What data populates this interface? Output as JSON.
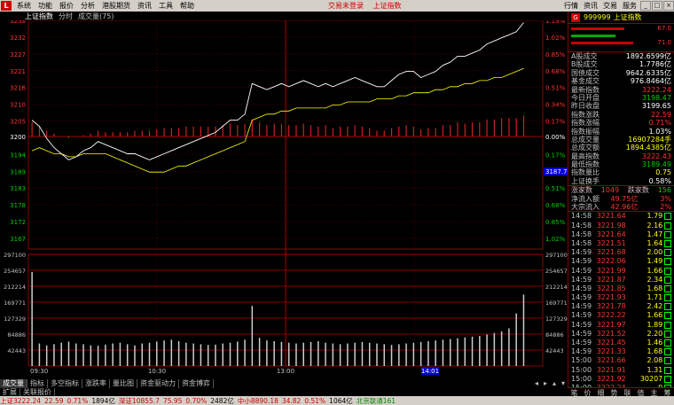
{
  "menu": {
    "logo": "L",
    "items": [
      "系统",
      "功能",
      "报价",
      "分析",
      "港股期货",
      "资讯",
      "工具",
      "帮助"
    ],
    "center": [
      "交易未登录",
      "上证指数"
    ],
    "right": [
      "行情",
      "资讯",
      "交易",
      "服务"
    ]
  },
  "header": {
    "index_name": "上证指数",
    "mode": "分时",
    "indicator": "成交量(75)"
  },
  "chart_data": {
    "type": "line",
    "y_left_ticks": [
      3238,
      3232,
      3227,
      3221,
      3216,
      3210,
      3205,
      3200,
      3194,
      3189,
      3183,
      3178,
      3172,
      3167
    ],
    "y_right_ticks": [
      "1.19%",
      "1.02%",
      "0.85%",
      "0.68%",
      "0.51%",
      "0.34%",
      "0.17%",
      "0.00%",
      "0.17%",
      "0.34%",
      "0.51%",
      "0.68%",
      "0.85%",
      "1.02%"
    ],
    "vol_ticks_left": [
      297100,
      254657,
      212214,
      169771,
      127329,
      84886,
      42443
    ],
    "vol_ticks_right": [
      297100,
      254657,
      212214,
      169771,
      127329,
      84886,
      42443
    ],
    "x_labels": [
      "09:30",
      "10:30",
      "13:00",
      "14:01"
    ],
    "base_price": 3199.65,
    "hover_price": "3187.74",
    "price_line": [
      3205,
      3203,
      3199,
      3196,
      3194,
      3192,
      3193,
      3195,
      3196,
      3198,
      3197,
      3196,
      3195,
      3194,
      3194,
      3193,
      3192,
      3193,
      3194,
      3195,
      3196,
      3197,
      3198,
      3199,
      3200,
      3201,
      3203,
      3205,
      3205,
      3207,
      3217,
      3216,
      3215,
      3216,
      3217,
      3216,
      3217,
      3218,
      3217,
      3216,
      3217,
      3216,
      3217,
      3218,
      3219,
      3218,
      3217,
      3216,
      3216,
      3218,
      3220,
      3221,
      3221,
      3219,
      3220,
      3221,
      3223,
      3224,
      3226,
      3226,
      3227,
      3228,
      3230,
      3231,
      3232,
      3233,
      3234,
      3237
    ],
    "avg_line": [
      3195,
      3196,
      3195,
      3194,
      3194,
      3193,
      3193,
      3194,
      3194,
      3194,
      3194,
      3193,
      3192,
      3191,
      3190,
      3189,
      3188,
      3188,
      3188,
      3189,
      3190,
      3190,
      3191,
      3192,
      3193,
      3194,
      3195,
      3196,
      3197,
      3198,
      3205,
      3206,
      3207,
      3207,
      3208,
      3208,
      3209,
      3209,
      3209,
      3209,
      3209,
      3210,
      3210,
      3211,
      3211,
      3211,
      3211,
      3212,
      3212,
      3212,
      3213,
      3213,
      3214,
      3214,
      3214,
      3215,
      3215,
      3216,
      3216,
      3217,
      3217,
      3218,
      3218,
      3219,
      3219,
      3220,
      3221,
      3222
    ],
    "volume": [
      250000,
      60000,
      55000,
      58000,
      62000,
      65000,
      60000,
      58000,
      55000,
      54000,
      57000,
      60000,
      62000,
      58000,
      55000,
      60000,
      62000,
      65000,
      68000,
      70000,
      66000,
      62000,
      60000,
      58000,
      56000,
      57000,
      60000,
      62000,
      65000,
      70000,
      160000,
      75000,
      68000,
      66000,
      64000,
      62000,
      60000,
      62000,
      64000,
      66000,
      62000,
      60000,
      58000,
      60000,
      62000,
      64000,
      62000,
      60000,
      58000,
      56000,
      58000,
      60000,
      62000,
      64000,
      66000,
      68000,
      70000,
      72000,
      74000,
      76000,
      78000,
      80000,
      84000,
      88000,
      92000,
      100000,
      140000,
      190000
    ]
  },
  "panel": {
    "g_label": "G",
    "code": "999999",
    "name": "上证指数",
    "bar_vals": [
      "67.0",
      "71.0"
    ],
    "kv": [
      {
        "k": "A股成交",
        "v": "1892.6599亿",
        "c": "wht"
      },
      {
        "k": "B股成交",
        "v": "1.7786亿",
        "c": "wht"
      },
      {
        "k": "国债成交",
        "v": "9642.6335亿",
        "c": "wht"
      },
      {
        "k": "基金成交",
        "v": "976.8464亿",
        "c": "wht"
      },
      {
        "k": "最新指数",
        "v": "3222.24",
        "c": "red"
      },
      {
        "k": "今日开盘",
        "v": "3198.47",
        "c": "grn"
      },
      {
        "k": "昨日收盘",
        "v": "3199.65",
        "c": "wht"
      },
      {
        "k": "指数涨跌",
        "v": "22.59",
        "c": "red"
      },
      {
        "k": "指数涨幅",
        "v": "0.71%",
        "c": "red"
      },
      {
        "k": "指数振幅",
        "v": "1.03%",
        "c": "wht"
      },
      {
        "k": "总成交量",
        "v": "16907284手",
        "c": "yel"
      },
      {
        "k": "总成交额",
        "v": "1894.4385亿",
        "c": "yel"
      },
      {
        "k": "最高指数",
        "v": "3222.43",
        "c": "red"
      },
      {
        "k": "最低指数",
        "v": "3189.49",
        "c": "grn"
      },
      {
        "k": "指数量比",
        "v": "0.75",
        "c": "yel"
      },
      {
        "k": "上证换手",
        "v": "0.58%",
        "c": "wht"
      }
    ],
    "stats": [
      {
        "k1": "涨家数",
        "v1": "1049",
        "k2": "跌家数",
        "v2": "156"
      },
      {
        "k1": "净流入额",
        "v1": "49.75亿",
        "k2": "",
        "v2": "3%"
      },
      {
        "k1": "大宗流入",
        "v1": "42.96亿",
        "k2": "",
        "v2": "2%"
      }
    ],
    "ticks": [
      {
        "t": "14:58",
        "p": "3221.64",
        "v": "1.79"
      },
      {
        "t": "14:58",
        "p": "3221.98",
        "v": "2.16"
      },
      {
        "t": "14:58",
        "p": "3221.64",
        "v": "1.47"
      },
      {
        "t": "14:58",
        "p": "3221.51",
        "v": "1.64"
      },
      {
        "t": "14:59",
        "p": "3221.68",
        "v": "2.00"
      },
      {
        "t": "14:59",
        "p": "3222.06",
        "v": "1.49"
      },
      {
        "t": "14:59",
        "p": "3221.99",
        "v": "1.66"
      },
      {
        "t": "14:59",
        "p": "3221.87",
        "v": "2.34"
      },
      {
        "t": "14:59",
        "p": "3221.85",
        "v": "1.68"
      },
      {
        "t": "14:59",
        "p": "3221.93",
        "v": "1.71"
      },
      {
        "t": "14:59",
        "p": "3221.78",
        "v": "2.42"
      },
      {
        "t": "14:59",
        "p": "3222.22",
        "v": "1.66"
      },
      {
        "t": "14:59",
        "p": "3221.97",
        "v": "1.89"
      },
      {
        "t": "14:59",
        "p": "3221.52",
        "v": "2.20"
      },
      {
        "t": "14:59",
        "p": "3221.45",
        "v": "1.46"
      },
      {
        "t": "14:59",
        "p": "3221.33",
        "v": "1.68"
      },
      {
        "t": "15:00",
        "p": "3221.66",
        "v": "2.08"
      },
      {
        "t": "15:00",
        "p": "3221.91",
        "v": "1.31"
      },
      {
        "t": "15:00",
        "p": "3221.92",
        "v": "30207"
      },
      {
        "t": "15:00",
        "p": "3222.24",
        "v": "0"
      }
    ],
    "foot": [
      "笔",
      "价",
      "细",
      "势",
      "联",
      "值",
      "主",
      "筹"
    ]
  },
  "tabs": [
    "成交量",
    "指标",
    "多空指标",
    "涨跌率",
    "量比图",
    "资金驱动力",
    "资金博弈"
  ],
  "subtabs": [
    "扩展",
    "关联报价"
  ],
  "status": {
    "sh": "上证3222.24",
    "sh_chg": "22.59",
    "sh_pct": "0.71%",
    "sh_amt": "1894亿",
    "sz": "深证10855.7",
    "sz_chg": "75.95",
    "sz_pct": "0.70%",
    "sz_amt": "2482亿",
    "zx": "中小8890.18",
    "zx_chg": "34.82",
    "zx_pct": "0.51%",
    "zx_amt": "1064亿",
    "server": "北京联通161"
  }
}
